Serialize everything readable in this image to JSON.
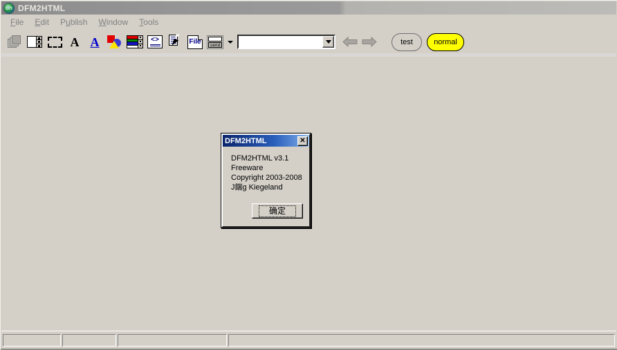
{
  "window": {
    "title": "DFM2HTML",
    "icon": "app-icon",
    "icon_text": "dh",
    "active": false
  },
  "menu": {
    "items": [
      {
        "label": "File",
        "accel": "F",
        "rest": "ile"
      },
      {
        "label": "Edit",
        "accel": "E",
        "rest": "dit"
      },
      {
        "label": "Publish",
        "accel": "P",
        "rest": "ublish"
      },
      {
        "label": "Window",
        "accel": "W",
        "rest": "indow"
      },
      {
        "label": "Tools",
        "accel": "T",
        "rest": "ools"
      }
    ]
  },
  "toolbar": {
    "buttons": [
      {
        "name": "pages-icon",
        "tooltip": "Pages"
      },
      {
        "name": "frame-icon",
        "tooltip": "Frame"
      },
      {
        "name": "selection-icon",
        "tooltip": "Selection"
      },
      {
        "name": "text-icon",
        "tooltip": "Text",
        "glyph": "A"
      },
      {
        "name": "link-text-icon",
        "tooltip": "Link Text",
        "glyph": "A"
      },
      {
        "name": "shapes-icon",
        "tooltip": "Shapes"
      },
      {
        "name": "table-icon",
        "tooltip": "Table"
      },
      {
        "name": "html-code-icon",
        "tooltip": "HTML Code"
      },
      {
        "name": "document-pointer-icon",
        "tooltip": "Select Document"
      },
      {
        "name": "file-icon",
        "tooltip": "File",
        "glyph": "File"
      },
      {
        "name": "send-form-icon",
        "tooltip": "Send Form",
        "glyph": "send"
      }
    ],
    "combo": {
      "value": "",
      "placeholder": ""
    },
    "back_label": "Back",
    "forward_label": "Forward",
    "test_button": "test",
    "normal_button": "normal",
    "normal_color": "#ffff00"
  },
  "dialog": {
    "title": "DFM2HTML",
    "close_label": "✕",
    "lines": [
      "DFM2HTML v3.1",
      "Freeware",
      "Copyright 2003-2008",
      "J鍴g Kiegeland"
    ],
    "ok_button": "确定"
  },
  "statusbar": {
    "panels": [
      "",
      "",
      "",
      ""
    ]
  },
  "colors": {
    "face": "#d4d0c8",
    "client": "#d4d0c8",
    "active_title_start": "#0a246a",
    "inactive_title": "#9a9a9a",
    "highlight_yellow": "#ffff00"
  }
}
